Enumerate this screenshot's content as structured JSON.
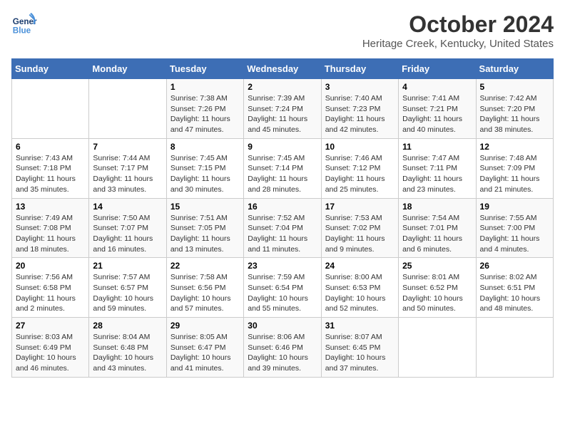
{
  "header": {
    "logo_text_general": "General",
    "logo_text_blue": "Blue",
    "title": "October 2024",
    "subtitle": "Heritage Creek, Kentucky, United States"
  },
  "weekdays": [
    "Sunday",
    "Monday",
    "Tuesday",
    "Wednesday",
    "Thursday",
    "Friday",
    "Saturday"
  ],
  "weeks": [
    [
      {
        "day": "",
        "info": ""
      },
      {
        "day": "",
        "info": ""
      },
      {
        "day": "1",
        "info": "Sunrise: 7:38 AM\nSunset: 7:26 PM\nDaylight: 11 hours and 47 minutes."
      },
      {
        "day": "2",
        "info": "Sunrise: 7:39 AM\nSunset: 7:24 PM\nDaylight: 11 hours and 45 minutes."
      },
      {
        "day": "3",
        "info": "Sunrise: 7:40 AM\nSunset: 7:23 PM\nDaylight: 11 hours and 42 minutes."
      },
      {
        "day": "4",
        "info": "Sunrise: 7:41 AM\nSunset: 7:21 PM\nDaylight: 11 hours and 40 minutes."
      },
      {
        "day": "5",
        "info": "Sunrise: 7:42 AM\nSunset: 7:20 PM\nDaylight: 11 hours and 38 minutes."
      }
    ],
    [
      {
        "day": "6",
        "info": "Sunrise: 7:43 AM\nSunset: 7:18 PM\nDaylight: 11 hours and 35 minutes."
      },
      {
        "day": "7",
        "info": "Sunrise: 7:44 AM\nSunset: 7:17 PM\nDaylight: 11 hours and 33 minutes."
      },
      {
        "day": "8",
        "info": "Sunrise: 7:45 AM\nSunset: 7:15 PM\nDaylight: 11 hours and 30 minutes."
      },
      {
        "day": "9",
        "info": "Sunrise: 7:45 AM\nSunset: 7:14 PM\nDaylight: 11 hours and 28 minutes."
      },
      {
        "day": "10",
        "info": "Sunrise: 7:46 AM\nSunset: 7:12 PM\nDaylight: 11 hours and 25 minutes."
      },
      {
        "day": "11",
        "info": "Sunrise: 7:47 AM\nSunset: 7:11 PM\nDaylight: 11 hours and 23 minutes."
      },
      {
        "day": "12",
        "info": "Sunrise: 7:48 AM\nSunset: 7:09 PM\nDaylight: 11 hours and 21 minutes."
      }
    ],
    [
      {
        "day": "13",
        "info": "Sunrise: 7:49 AM\nSunset: 7:08 PM\nDaylight: 11 hours and 18 minutes."
      },
      {
        "day": "14",
        "info": "Sunrise: 7:50 AM\nSunset: 7:07 PM\nDaylight: 11 hours and 16 minutes."
      },
      {
        "day": "15",
        "info": "Sunrise: 7:51 AM\nSunset: 7:05 PM\nDaylight: 11 hours and 13 minutes."
      },
      {
        "day": "16",
        "info": "Sunrise: 7:52 AM\nSunset: 7:04 PM\nDaylight: 11 hours and 11 minutes."
      },
      {
        "day": "17",
        "info": "Sunrise: 7:53 AM\nSunset: 7:02 PM\nDaylight: 11 hours and 9 minutes."
      },
      {
        "day": "18",
        "info": "Sunrise: 7:54 AM\nSunset: 7:01 PM\nDaylight: 11 hours and 6 minutes."
      },
      {
        "day": "19",
        "info": "Sunrise: 7:55 AM\nSunset: 7:00 PM\nDaylight: 11 hours and 4 minutes."
      }
    ],
    [
      {
        "day": "20",
        "info": "Sunrise: 7:56 AM\nSunset: 6:58 PM\nDaylight: 11 hours and 2 minutes."
      },
      {
        "day": "21",
        "info": "Sunrise: 7:57 AM\nSunset: 6:57 PM\nDaylight: 10 hours and 59 minutes."
      },
      {
        "day": "22",
        "info": "Sunrise: 7:58 AM\nSunset: 6:56 PM\nDaylight: 10 hours and 57 minutes."
      },
      {
        "day": "23",
        "info": "Sunrise: 7:59 AM\nSunset: 6:54 PM\nDaylight: 10 hours and 55 minutes."
      },
      {
        "day": "24",
        "info": "Sunrise: 8:00 AM\nSunset: 6:53 PM\nDaylight: 10 hours and 52 minutes."
      },
      {
        "day": "25",
        "info": "Sunrise: 8:01 AM\nSunset: 6:52 PM\nDaylight: 10 hours and 50 minutes."
      },
      {
        "day": "26",
        "info": "Sunrise: 8:02 AM\nSunset: 6:51 PM\nDaylight: 10 hours and 48 minutes."
      }
    ],
    [
      {
        "day": "27",
        "info": "Sunrise: 8:03 AM\nSunset: 6:49 PM\nDaylight: 10 hours and 46 minutes."
      },
      {
        "day": "28",
        "info": "Sunrise: 8:04 AM\nSunset: 6:48 PM\nDaylight: 10 hours and 43 minutes."
      },
      {
        "day": "29",
        "info": "Sunrise: 8:05 AM\nSunset: 6:47 PM\nDaylight: 10 hours and 41 minutes."
      },
      {
        "day": "30",
        "info": "Sunrise: 8:06 AM\nSunset: 6:46 PM\nDaylight: 10 hours and 39 minutes."
      },
      {
        "day": "31",
        "info": "Sunrise: 8:07 AM\nSunset: 6:45 PM\nDaylight: 10 hours and 37 minutes."
      },
      {
        "day": "",
        "info": ""
      },
      {
        "day": "",
        "info": ""
      }
    ]
  ]
}
